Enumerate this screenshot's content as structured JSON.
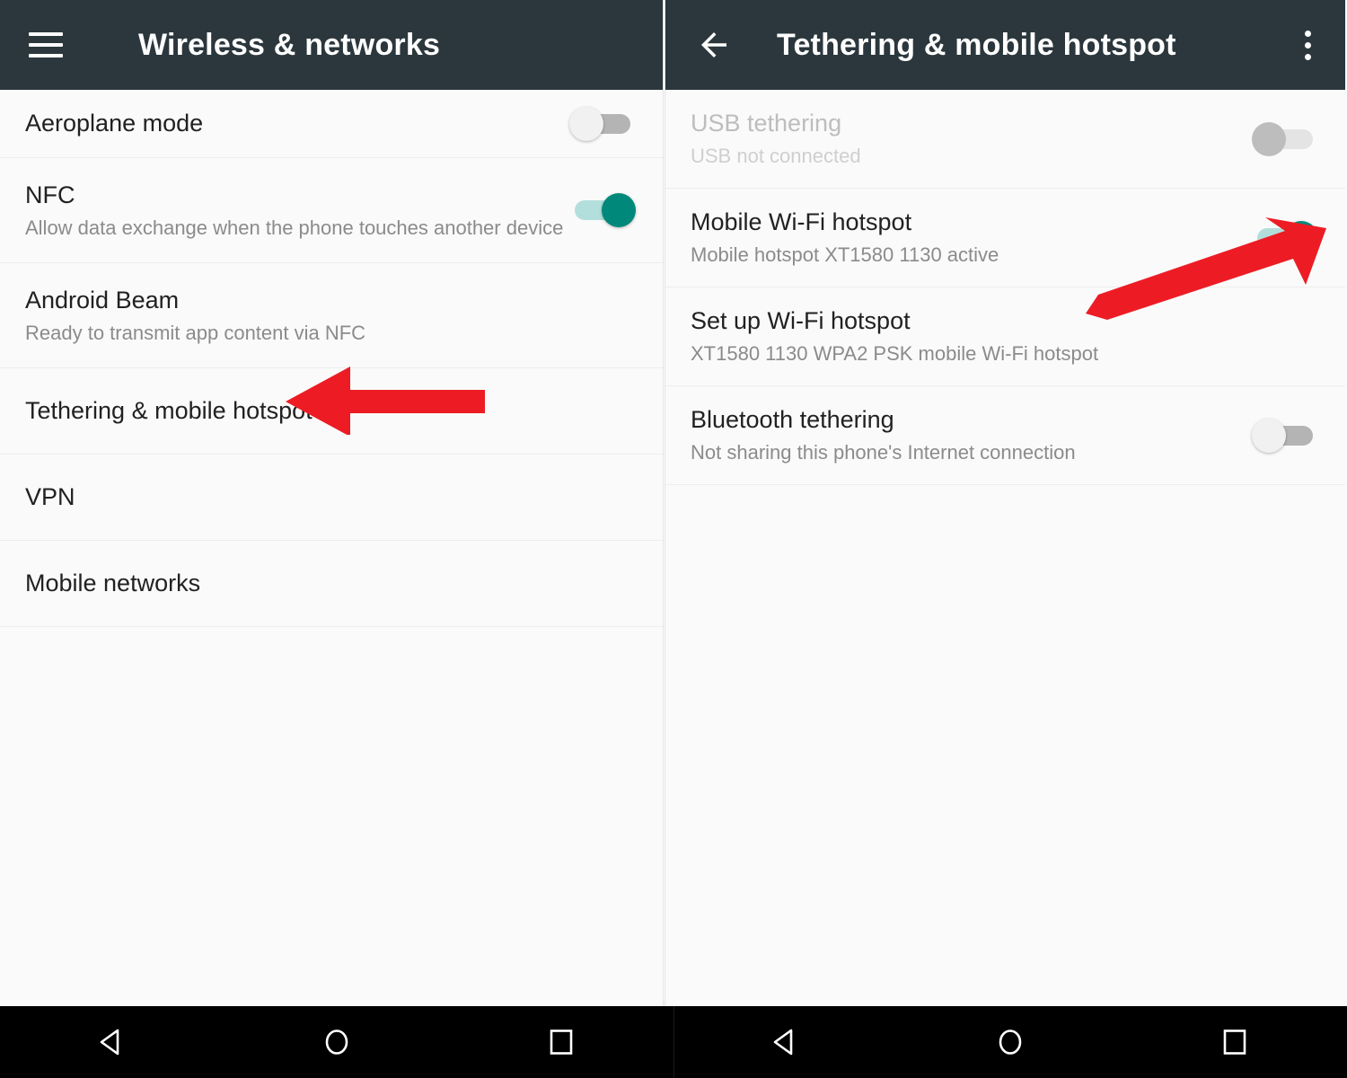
{
  "left_pane": {
    "appbar": {
      "menu_icon": "hamburger-menu-icon",
      "title": "Wireless & networks"
    },
    "rows": [
      {
        "name": "aeroplane-mode",
        "title": "Aeroplane mode",
        "subtitle": "",
        "switch": "off"
      },
      {
        "name": "nfc",
        "title": "NFC",
        "subtitle": "Allow data exchange when the phone touches another device",
        "switch": "on"
      },
      {
        "name": "android-beam",
        "title": "Android Beam",
        "subtitle": "Ready to transmit app content via NFC",
        "switch": "none"
      },
      {
        "name": "tethering-mobile-hotspot",
        "title": "Tethering & mobile hotspot",
        "subtitle": "",
        "switch": "none"
      },
      {
        "name": "vpn",
        "title": "VPN",
        "subtitle": "",
        "switch": "none"
      },
      {
        "name": "mobile-networks",
        "title": "Mobile networks",
        "subtitle": "",
        "switch": "none"
      }
    ],
    "annotation": {
      "type": "left-pointing-arrow",
      "points_at": "Tethering & mobile hotspot",
      "color": "#ED1C24"
    }
  },
  "right_pane": {
    "appbar": {
      "back_icon": "back-arrow-icon",
      "title": "Tethering & mobile hotspot",
      "overflow_icon": "overflow-menu-icon"
    },
    "rows": [
      {
        "name": "usb-tethering",
        "title": "USB tethering",
        "subtitle": "USB not connected",
        "switch": "off-disabled",
        "disabled": true
      },
      {
        "name": "mobile-wifi-hotspot",
        "title": "Mobile Wi-Fi hotspot",
        "subtitle": "Mobile hotspot XT1580 1130 active",
        "switch": "on",
        "disabled": false
      },
      {
        "name": "set-up-wifi-hotspot",
        "title": "Set up Wi-Fi hotspot",
        "subtitle": "XT1580 1130 WPA2 PSK mobile Wi-Fi hotspot",
        "switch": "none",
        "disabled": false
      },
      {
        "name": "bluetooth-tethering",
        "title": "Bluetooth tethering",
        "subtitle": "Not sharing this phone's Internet connection",
        "switch": "off",
        "disabled": false
      }
    ],
    "annotation": {
      "type": "diagonal-arrow-up-right",
      "points_at": "Mobile Wi-Fi hotspot switch",
      "color": "#ED1C24"
    }
  },
  "navbar": {
    "buttons": [
      {
        "name": "back-button",
        "icon": "triangle-back-icon"
      },
      {
        "name": "home-button",
        "icon": "circle-home-icon"
      },
      {
        "name": "recents-button",
        "icon": "square-recents-icon"
      }
    ]
  },
  "colors": {
    "appbar_bg": "#2b373d",
    "page_bg": "#fafafa",
    "accent_on": "#00897b",
    "accent_track": "#b2dfdb",
    "annotation_red": "#ED1C24",
    "navbar_bg": "#000000"
  }
}
